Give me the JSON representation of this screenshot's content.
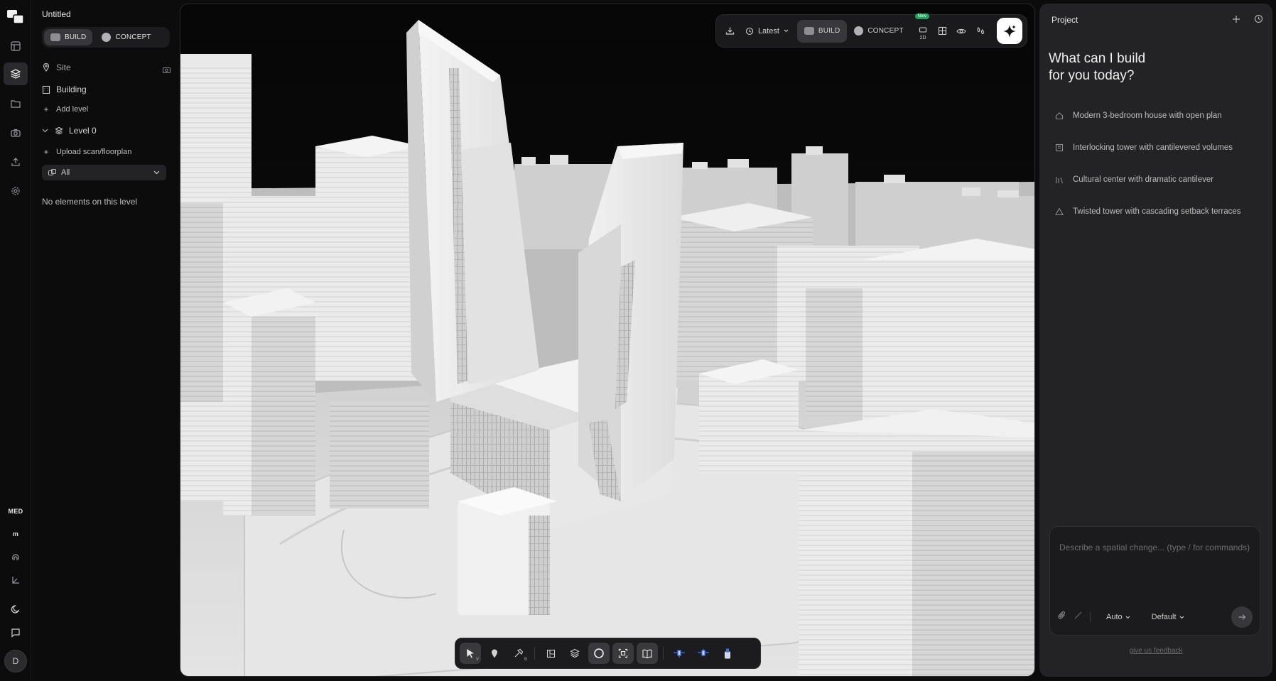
{
  "doc": {
    "title": "Untitled"
  },
  "mode_toggle": {
    "build": "BUILD",
    "concept": "CONCEPT"
  },
  "tree": {
    "site": "Site",
    "building": "Building",
    "add_level": "Add level",
    "level": "Level 0",
    "upload": "Upload scan/floorplan",
    "filter_value": "All",
    "empty": "No elements on this level"
  },
  "rail": {
    "quality": "MED",
    "units": "m",
    "user_initial": "D",
    "icons": [
      "logo-icon",
      "layout-icon",
      "layers-icon",
      "folder-icon",
      "camera-icon",
      "upload-icon",
      "settings-icon",
      "quality-label",
      "units-label",
      "fingerprint-icon",
      "axis-icon",
      "moon-icon",
      "chat-icon"
    ]
  },
  "topbar": {
    "version": "Latest",
    "build": "BUILD",
    "concept": "CONCEPT",
    "new_badge": "New",
    "plan_2d": "2D"
  },
  "project": {
    "title": "Project",
    "hero_line1": "What can I build",
    "hero_line2": "for you today?",
    "suggestions": [
      {
        "icon": "house-icon",
        "text": "Modern 3-bedroom house with open plan"
      },
      {
        "icon": "tower-icon",
        "text": "Interlocking tower with cantilevered volumes"
      },
      {
        "icon": "columns-icon",
        "text": "Cultural center with dramatic cantilever"
      },
      {
        "icon": "triangle-icon",
        "text": "Twisted tower with cascading setback terraces"
      }
    ],
    "placeholder": "Describe a spatial change... (type / for commands)",
    "mode": "Auto",
    "model": "Default",
    "feedback": "give us feedback"
  },
  "dock": {
    "select_key": "V",
    "build_key": "B"
  },
  "colors": {
    "accent_green": "#1fa35b",
    "panel": "#232325",
    "background": "#0c0c0d"
  }
}
